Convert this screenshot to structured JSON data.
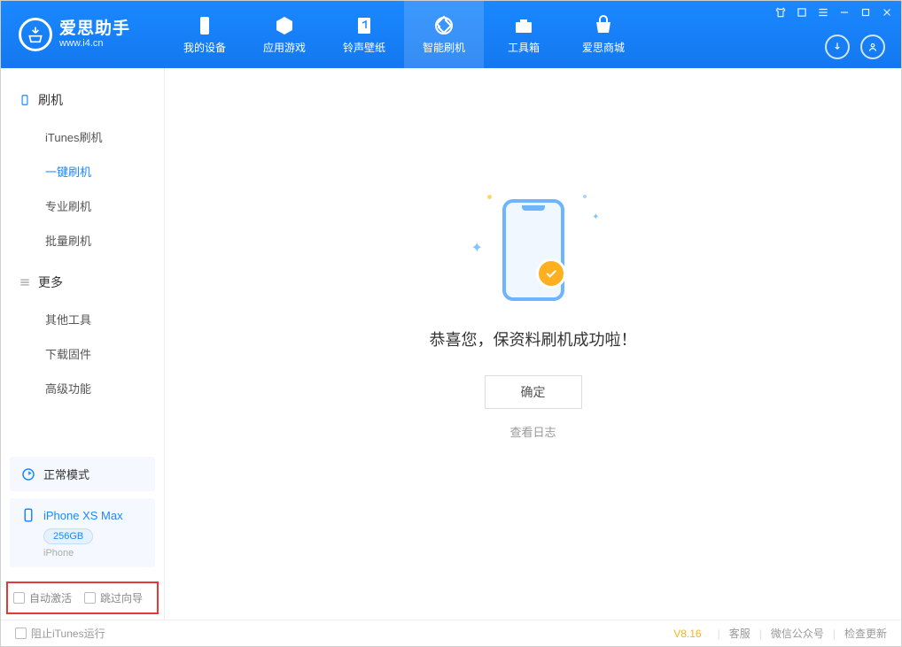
{
  "app": {
    "name": "爱思助手",
    "url": "www.i4.cn"
  },
  "nav": {
    "device": "我的设备",
    "apps": "应用游戏",
    "ringtone": "铃声壁纸",
    "flash": "智能刷机",
    "toolbox": "工具箱",
    "store": "爱思商城"
  },
  "sidebar": {
    "flash_section": "刷机",
    "items_flash": [
      "iTunes刷机",
      "一键刷机",
      "专业刷机",
      "批量刷机"
    ],
    "more_section": "更多",
    "items_more": [
      "其他工具",
      "下载固件",
      "高级功能"
    ],
    "mode": "正常模式",
    "device_name": "iPhone XS Max",
    "device_storage": "256GB",
    "device_type": "iPhone",
    "chk_auto_activate": "自动激活",
    "chk_skip_guide": "跳过向导"
  },
  "result": {
    "message": "恭喜您，保资料刷机成功啦！",
    "ok": "确定",
    "view_log": "查看日志"
  },
  "footer": {
    "block_itunes": "阻止iTunes运行",
    "version": "V8.16",
    "support": "客服",
    "wechat": "微信公众号",
    "check_update": "检查更新"
  }
}
